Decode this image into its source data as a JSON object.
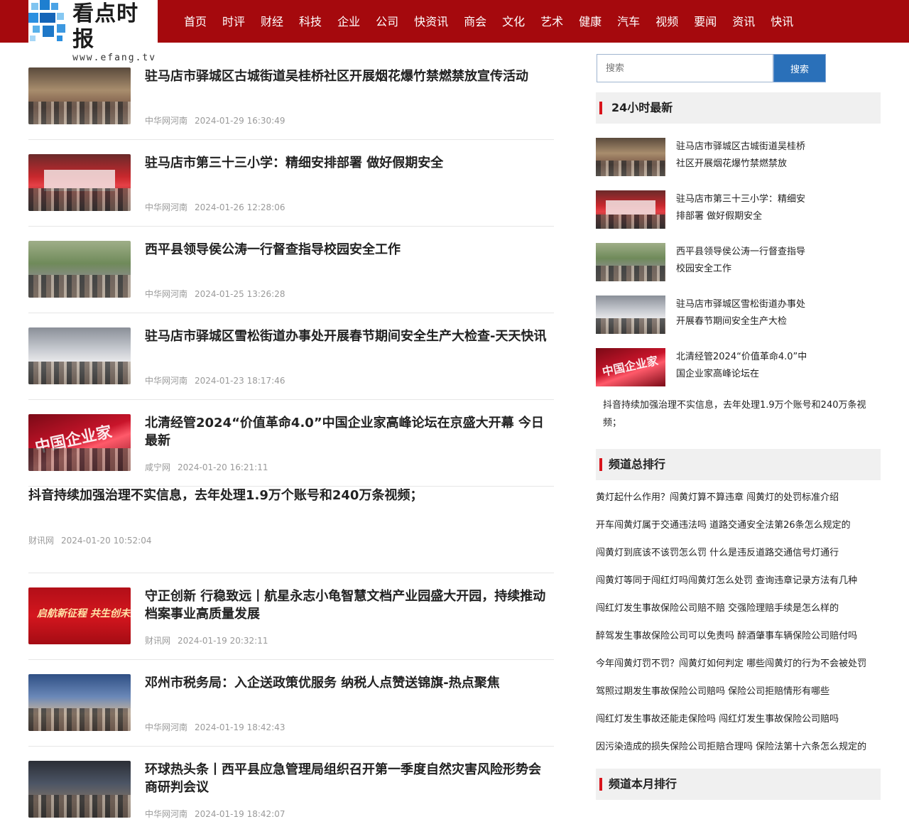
{
  "header": {
    "logo_title": "看点时报",
    "logo_url": "www.efang.tv",
    "nav": [
      "首页",
      "时评",
      "财经",
      "科技",
      "企业",
      "公司",
      "快资讯",
      "商会",
      "文化",
      "艺术",
      "健康",
      "汽车",
      "视频",
      "要闻",
      "资讯",
      "快讯"
    ]
  },
  "articles": [
    {
      "title": "驻马店市驿城区古城街道吴桂桥社区开展烟花爆竹禁燃禁放宣传活动",
      "source": "中华网河南",
      "time": "2024-01-29 16:30:49"
    },
    {
      "title": "驻马店市第三十三小学：精细安排部署 做好假期安全",
      "source": "中华网河南",
      "time": "2024-01-26 12:28:06"
    },
    {
      "title": "西平县领导侯公涛一行督查指导校园安全工作",
      "source": "中华网河南",
      "time": "2024-01-25 13:26:28"
    },
    {
      "title": "驻马店市驿城区雪松街道办事处开展春节期间安全生产大检查-天天快讯",
      "source": "中华网河南",
      "time": "2024-01-23 18:17:46"
    },
    {
      "title": "北清经管2024“价值革命4.0”中国企业家高峰论坛在京盛大开幕 今日最新",
      "source": "咸宁网",
      "time": "2024-01-20 16:21:11"
    },
    {
      "title": "抖音持续加强治理不实信息，去年处理1.9万个账号和240万条视频；",
      "source": "财讯网",
      "time": "2024-01-20 10:52:04"
    },
    {
      "title": "守正创新 行稳致远丨航星永志小龟智慧文档产业园盛大开园，持续推动档案事业高质量发展",
      "source": "财讯网",
      "time": "2024-01-19 20:32:11"
    },
    {
      "title": "邓州市税务局：入企送政策优服务 纳税人点赞送锦旗-热点聚焦",
      "source": "中华网河南",
      "time": "2024-01-19 18:42:43"
    },
    {
      "title": "环球热头条丨西平县应急管理局组织召开第一季度自然灾害风险形势会商研判会议",
      "source": "中华网河南",
      "time": "2024-01-19 18:42:07"
    }
  ],
  "thumb_text": {
    "banner": "启航新征程 共生创未来",
    "forum": "中国企业家"
  },
  "sidebar": {
    "search_placeholder": "搜索",
    "search_button": "搜索",
    "latest_heading": "24小时最新",
    "latest": [
      "驻马店市驿城区古城街道吴桂桥社区开展烟花爆竹禁燃禁放",
      "驻马店市第三十三小学：精细安排部署 做好假期安全",
      "西平县领导侯公涛一行督查指导校园安全工作",
      "驻马店市驿城区雪松街道办事处开展春节期间安全生产大检",
      "北清经管2024“价值革命4.0”中国企业家高峰论坛在"
    ],
    "latest_text_only": "抖音持续加强治理不实信息，去年处理1.9万个账号和240万条视频；",
    "rank_heading": "频道总排行",
    "rank": [
      "黄灯起什么作用？闯黄灯算不算违章 闯黄灯的处罚标准介绍",
      "开车闯黄灯属于交通违法吗 道路交通安全法第26条怎么规定的",
      "闯黄灯到底该不该罚怎么罚 什么是违反道路交通信号灯通行",
      "闯黄灯等同于闯红灯吗闯黄灯怎么处罚 查询违章记录方法有几种",
      "闯红灯发生事故保险公司赔不赔 交强险理赔手续是怎么样的",
      "醉驾发生事故保险公司可以免责吗 醉酒肇事车辆保险公司赔付吗",
      "今年闯黄灯罚不罚？闯黄灯如何判定 哪些闯黄灯的行为不会被处罚",
      "驾照过期发生事故保险公司赔吗 保险公司拒赔情形有哪些",
      "闯红灯发生事故还能走保险吗 闯红灯发生事故保险公司赔吗",
      "因污染造成的损失保险公司拒赔合理吗 保险法第十六条怎么规定的"
    ],
    "month_heading": "频道本月排行"
  },
  "colors": {
    "header_bg": "#a5090d",
    "search_button": "#2a70b9",
    "heading_accent": "#d9141b"
  }
}
